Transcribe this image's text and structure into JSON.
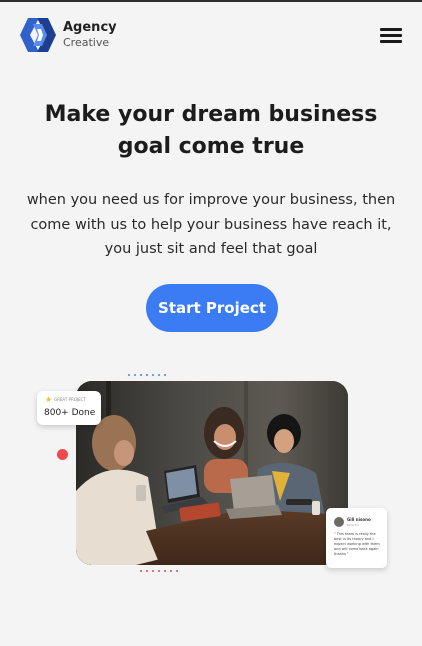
{
  "header": {
    "brand_title": "Agency",
    "brand_subtitle": "Creative",
    "logo_icon": "agency-logo",
    "menu_icon": "hamburger-menu-icon"
  },
  "hero": {
    "title": "Make your dream business goal come true",
    "description": "when you need us for improve your business, then come with us to help your business have reach it, you just sit and feel that goal",
    "cta_label": "Start Project"
  },
  "stat_card": {
    "label": "GREAT PROJECT",
    "value": "800+ Done",
    "icon": "star-icon"
  },
  "review_card": {
    "name": "Gill nisono",
    "role": "Director",
    "quote": "\" This team is really the best in its theory and I expect working with them and will come back again thanks \""
  },
  "colors": {
    "accent": "#3b7cf4",
    "background": "#f4f4f5",
    "red_dot": "#ef4b4b",
    "star": "#f5b82e"
  }
}
